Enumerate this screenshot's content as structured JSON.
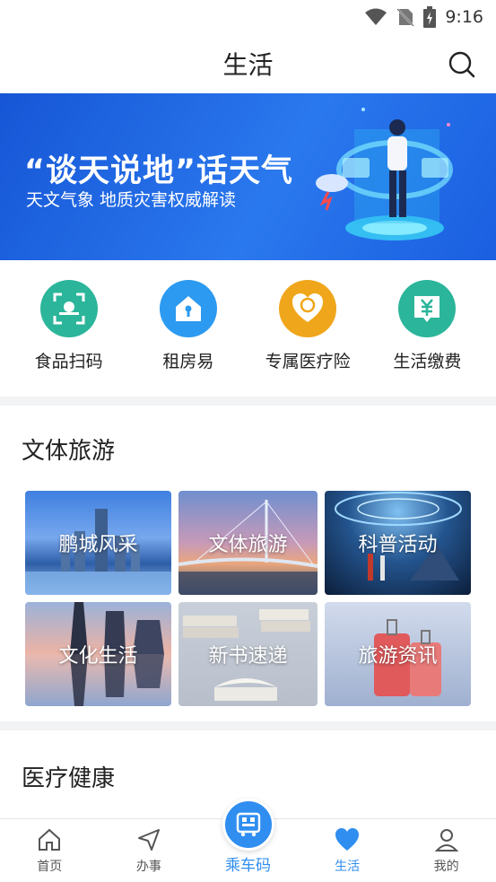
{
  "status_bar": {
    "time": "9:16"
  },
  "header": {
    "title": "生活"
  },
  "banner": {
    "headline": "“谈天说地”话天气",
    "subtitle": "天文气象 地质灾害权威解读"
  },
  "shortcuts": [
    {
      "label": "食品扫码",
      "icon": "scan-icon",
      "color": "#2bb59a"
    },
    {
      "label": "租房易",
      "icon": "house-icon",
      "color": "#2c9af0"
    },
    {
      "label": "专属医疗险",
      "icon": "heart-shield-icon",
      "color": "#f0a61b"
    },
    {
      "label": "生活缴费",
      "icon": "yuan-icon",
      "color": "#2bb59a"
    }
  ],
  "culture_section": {
    "title": "文体旅游",
    "tiles": [
      {
        "label": "鹏城风采"
      },
      {
        "label": "文体旅游"
      },
      {
        "label": "科普活动"
      },
      {
        "label": "文化生活"
      },
      {
        "label": "新书速递"
      },
      {
        "label": "旅游资讯"
      }
    ]
  },
  "health_section": {
    "title": "医疗健康"
  },
  "tabbar": {
    "items": [
      {
        "label": "首页",
        "icon": "home-icon"
      },
      {
        "label": "办事",
        "icon": "send-icon"
      },
      {
        "label": "乘车码",
        "icon": "bus-qr-icon"
      },
      {
        "label": "生活",
        "icon": "heart-icon"
      },
      {
        "label": "我的",
        "icon": "user-icon"
      }
    ],
    "active": "生活"
  },
  "colors": {
    "accent": "#2f8ef0",
    "banner_blue": "#1a5fe0"
  }
}
